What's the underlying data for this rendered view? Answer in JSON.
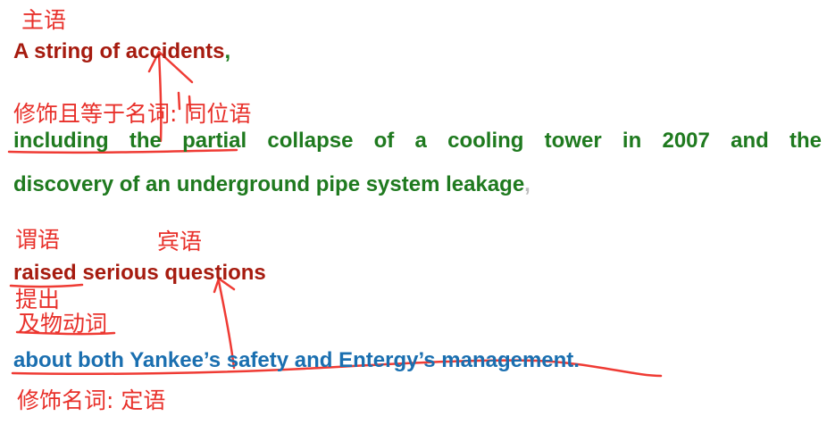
{
  "sentence": {
    "subject": "A string of accidents",
    "subject_comma": ",",
    "appositive": "including the partial collapse of a cooling tower in 2007 and the",
    "appositive_cont": "discovery of an underground pipe system leakage",
    "appositive_comma": ",",
    "predicate_verb": "raised",
    "predicate_object": "serious questions",
    "modifier": "about both Yankee’s safety and Entergy’s management."
  },
  "annotations": {
    "subject_label": "主语",
    "appositive_label": "修饰且等于名词: 同位语",
    "predicate_label": "谓语",
    "object_label": "宾语",
    "verb_meaning": "提出",
    "verb_type": "及物动词",
    "modifier_label": "修饰名词: 定语"
  },
  "colors": {
    "subject": "#a61b0f",
    "appositive": "#1f7a1f",
    "modifier": "#1a6fb0",
    "annotation": "#e8302a"
  }
}
